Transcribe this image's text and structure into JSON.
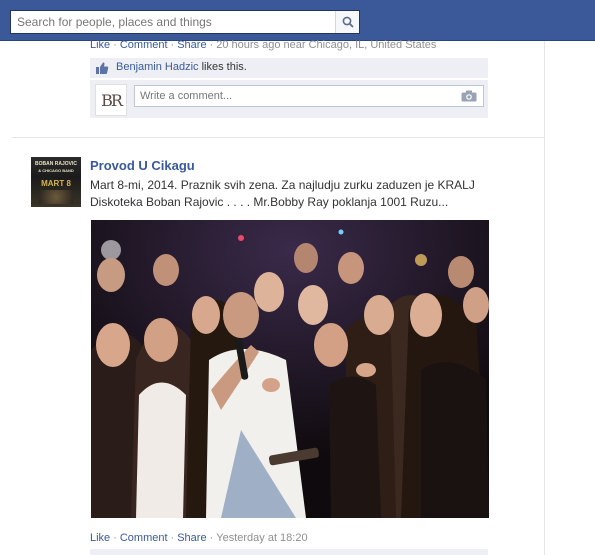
{
  "header": {
    "search_placeholder": "Search for people, places and things"
  },
  "post1": {
    "actions": {
      "like": "Like",
      "comment": "Comment",
      "share": "Share",
      "meta": "20 hours ago near Chicago, IL, United States"
    },
    "likes": {
      "name": "Benjamin Hadzic",
      "suffix": "likes this."
    },
    "comment_placeholder": "Write a comment...",
    "avatar_initials": "BR"
  },
  "post2": {
    "title": "Provod U Cikagu",
    "text_line1": "Mart 8-mi, 2014. Praznik svih zena. Za najludju zurku zaduzen je KRALJ",
    "text_line2": "Diskoteka Boban Rajovic . . . . Mr.Bobby Ray poklanja 1001 Ruzu...",
    "album_lines": [
      "BOBAN RAJOVIC",
      "& CHICAGO BAND",
      "MART 8"
    ],
    "actions": {
      "like": "Like",
      "comment": "Comment",
      "share": "Share",
      "meta": "Yesterday at 18:20"
    }
  },
  "colors": {
    "brand": "#3b5998",
    "link": "#3b5998",
    "meta": "#8f8f8f",
    "panel": "#edeff4"
  },
  "icons": [
    "search-icon",
    "like-thumb-icon",
    "camera-icon"
  ]
}
